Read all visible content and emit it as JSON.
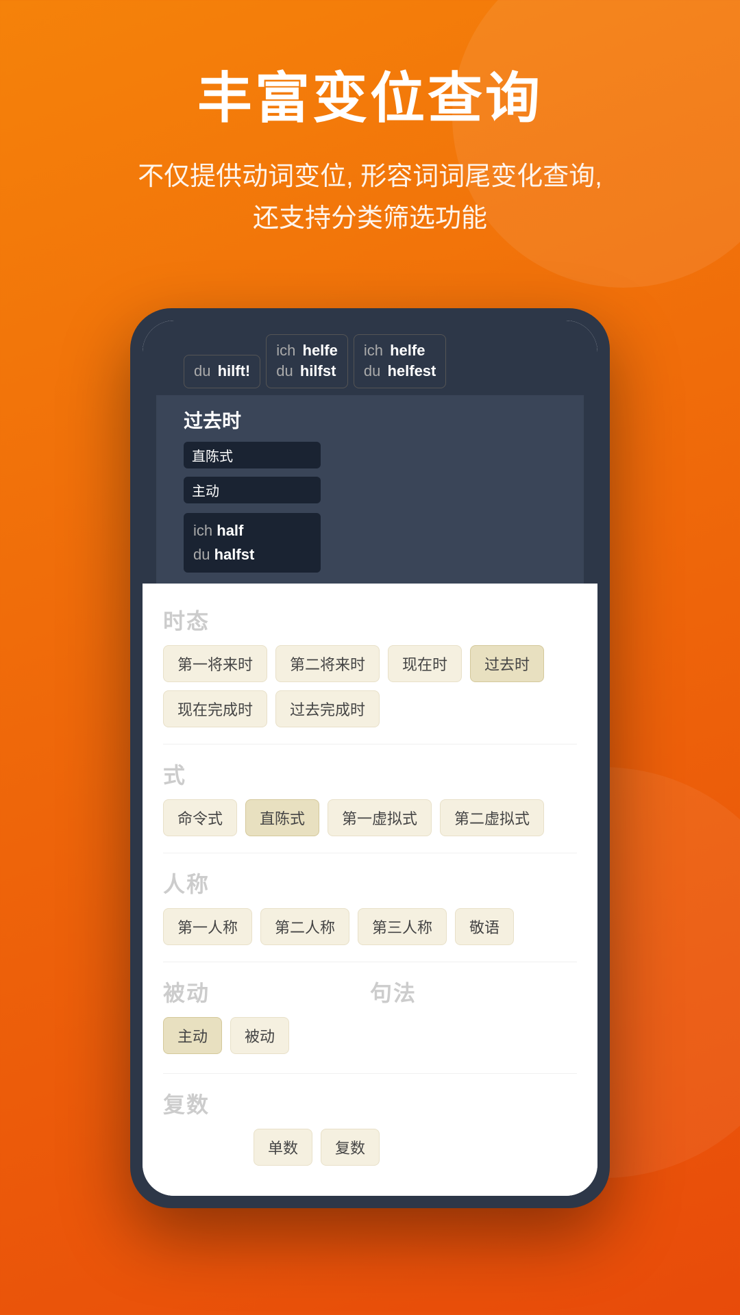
{
  "page": {
    "title": "丰富变位查询",
    "subtitle_line1": "不仅提供动词变位, 形容词词尾变化查询,",
    "subtitle_line2": "还支持分类筛选功能"
  },
  "phone": {
    "tooltips": [
      {
        "pronoun": "du",
        "verb": "hilft",
        "active": false
      },
      {
        "pronoun": "ich",
        "verb": "helfe",
        "sub_pronoun": "du",
        "sub_verb": "hilfst",
        "active": false
      },
      {
        "pronoun": "ich",
        "verb": "helfe",
        "sub_pronoun": "du",
        "sub_verb": "helfest",
        "active": false
      }
    ],
    "tense_section": {
      "label": "过去时",
      "badge_mode": "直陈式",
      "badge_voice": "主动",
      "conj_line1_pronoun": "ich",
      "conj_line1_verb": "half",
      "conj_line2_pronoun": "du",
      "conj_line2_verb": "halfst"
    },
    "filters": {
      "tense": {
        "label": "时态",
        "tags": [
          "第一将来时",
          "第二将来时",
          "现在时",
          "过去时",
          "现在完成时",
          "过去完成时"
        ]
      },
      "mode": {
        "label": "式",
        "tags": [
          "命令式",
          "直陈式",
          "第一虚拟式",
          "第二虚拟式"
        ]
      },
      "person": {
        "label": "人称",
        "tags": [
          "第一人称",
          "第二人称",
          "第三人称",
          "敬语"
        ]
      },
      "voice": {
        "label": "被动",
        "tags": [
          "主动",
          "被动"
        ]
      },
      "syntax": {
        "label": "句法",
        "tags": []
      },
      "number": {
        "label": "复数",
        "tags": [
          "单数",
          "复数"
        ]
      }
    }
  }
}
